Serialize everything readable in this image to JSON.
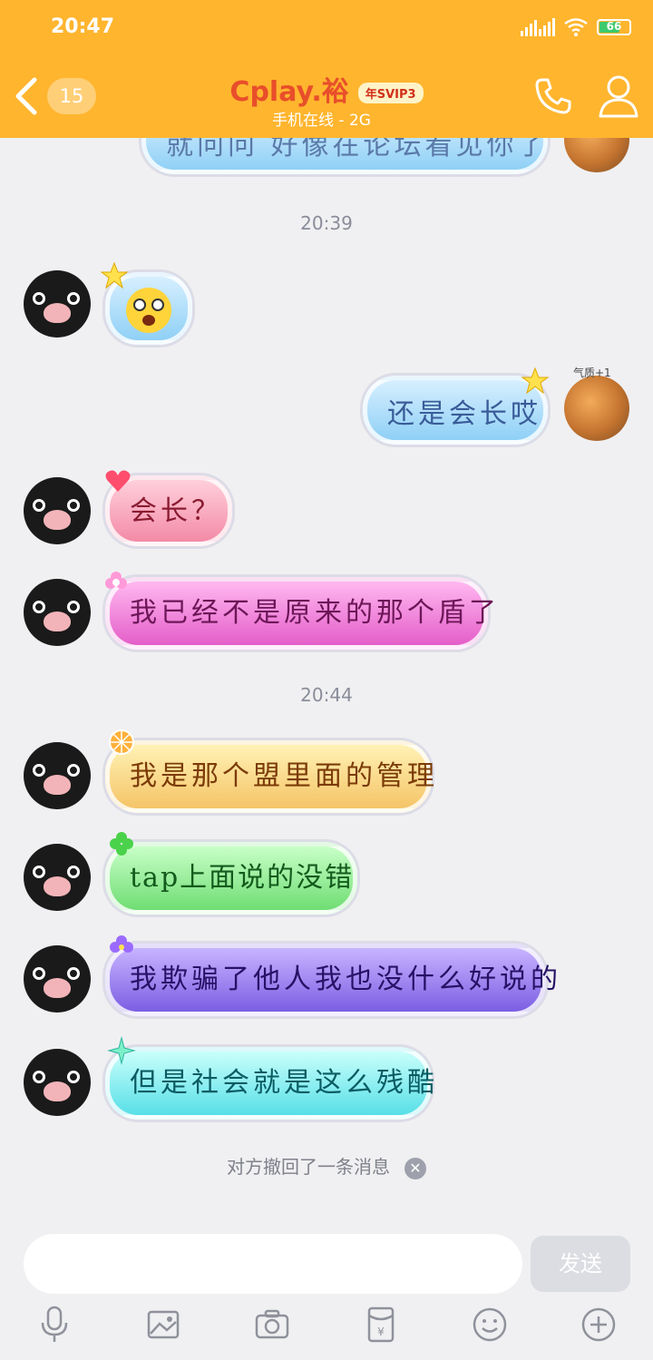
{
  "status_bar": {
    "time": "20:47",
    "battery": "66",
    "accent": "#ffb52e"
  },
  "header": {
    "unread_count": "15",
    "title": "Cplay.裕",
    "vip_badge": "年SVIP3",
    "subtitle": "手机在线 - 2G"
  },
  "chat": {
    "top_partial_text": "就问问  好像在论坛看见你了",
    "dividers": [
      "20:39",
      "20:44"
    ],
    "qizhi_label": "气质+1",
    "messages": [
      {
        "side": "left",
        "type": "emoji",
        "emoji": "surprised-face",
        "bubble_color": "#8fd0f6"
      },
      {
        "side": "right",
        "text": "还是会长哎",
        "bubble_color": "#8fd0f6"
      },
      {
        "side": "left",
        "text": "会长？",
        "bubble_color": "#f38aa6"
      },
      {
        "side": "left",
        "text": "我已经不是原来的那个盾了",
        "bubble_color": "#e45ec9"
      },
      {
        "side": "left",
        "text": "我是那个盟里面的管理",
        "bubble_color": "#f5c467"
      },
      {
        "side": "left",
        "text": "tap上面说的没错",
        "bubble_color": "#6fdd73"
      },
      {
        "side": "left",
        "text": "我欺骗了他人我也没什么好说的",
        "bubble_color": "#7b5ee3"
      },
      {
        "side": "left",
        "text": "但是社会就是这么残酷",
        "bubble_color": "#57dfe7"
      }
    ],
    "recall_notice": "对方撤回了一条消息"
  },
  "input_bar": {
    "placeholder": "",
    "send_label": "发送"
  },
  "toolbar": {
    "icons": [
      "microphone-icon",
      "image-icon",
      "camera-icon",
      "red-packet-icon",
      "smiley-icon",
      "plus-icon"
    ]
  }
}
